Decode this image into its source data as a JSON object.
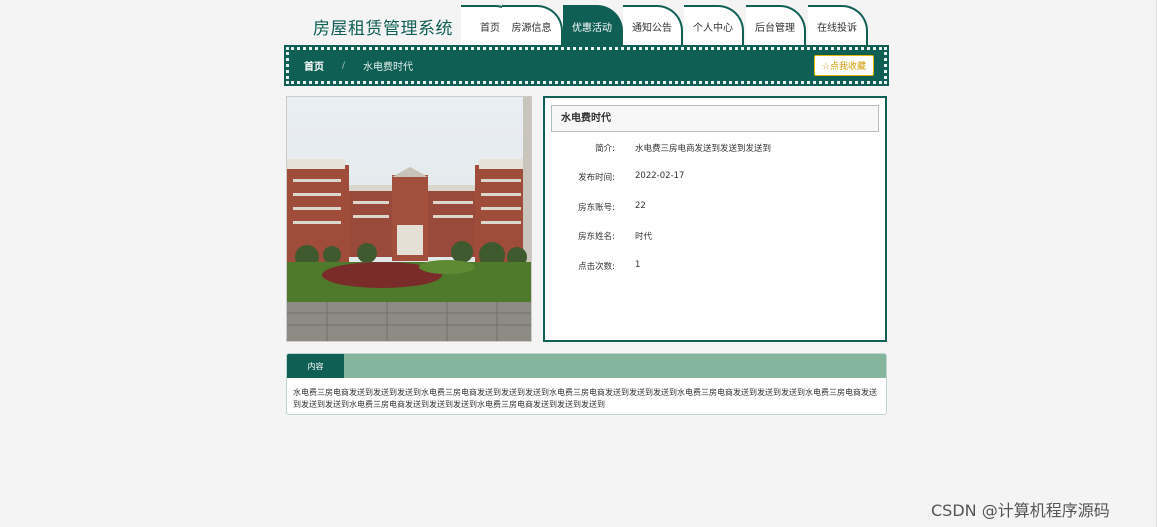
{
  "header": {
    "site_title": "房屋租赁管理系统"
  },
  "nav": {
    "tabs": [
      {
        "label": "首页",
        "active": false
      },
      {
        "label": "房源信息",
        "active": false
      },
      {
        "label": "优惠活动",
        "active": true
      },
      {
        "label": "通知公告",
        "active": false
      },
      {
        "label": "个人中心",
        "active": false
      },
      {
        "label": "后台管理",
        "active": false
      },
      {
        "label": "在线投诉",
        "active": false
      }
    ]
  },
  "breadcrumb": {
    "home": "首页",
    "separator": "/",
    "current": "水电费时代",
    "favorite_button": "☆点我收藏"
  },
  "detail": {
    "title": "水电费时代",
    "fields": [
      {
        "label": "简介:",
        "value": "水电费三房电商发送到发送到发送到"
      },
      {
        "label": "发布时间:",
        "value": "2022-02-17"
      },
      {
        "label": "房东账号:",
        "value": "22"
      },
      {
        "label": "房东姓名:",
        "value": "时代"
      },
      {
        "label": "点击次数:",
        "value": "1"
      }
    ]
  },
  "content": {
    "tab_label": "内容",
    "text": "水电费三房电商发送到发送到发送到水电费三房电商发送到发送到发送到水电费三房电商发送到发送到发送到水电费三房电商发送到发送到发送到水电费三房电商发送到发送到发送到水电费三房电商发送到发送到发送到水电费三房电商发送到发送到发送到"
  },
  "watermark": "CSDN @计算机程序源码",
  "colors": {
    "brand": "#0f5f55",
    "tab_bar": "#85b59d",
    "favorite": "#e6b800"
  }
}
